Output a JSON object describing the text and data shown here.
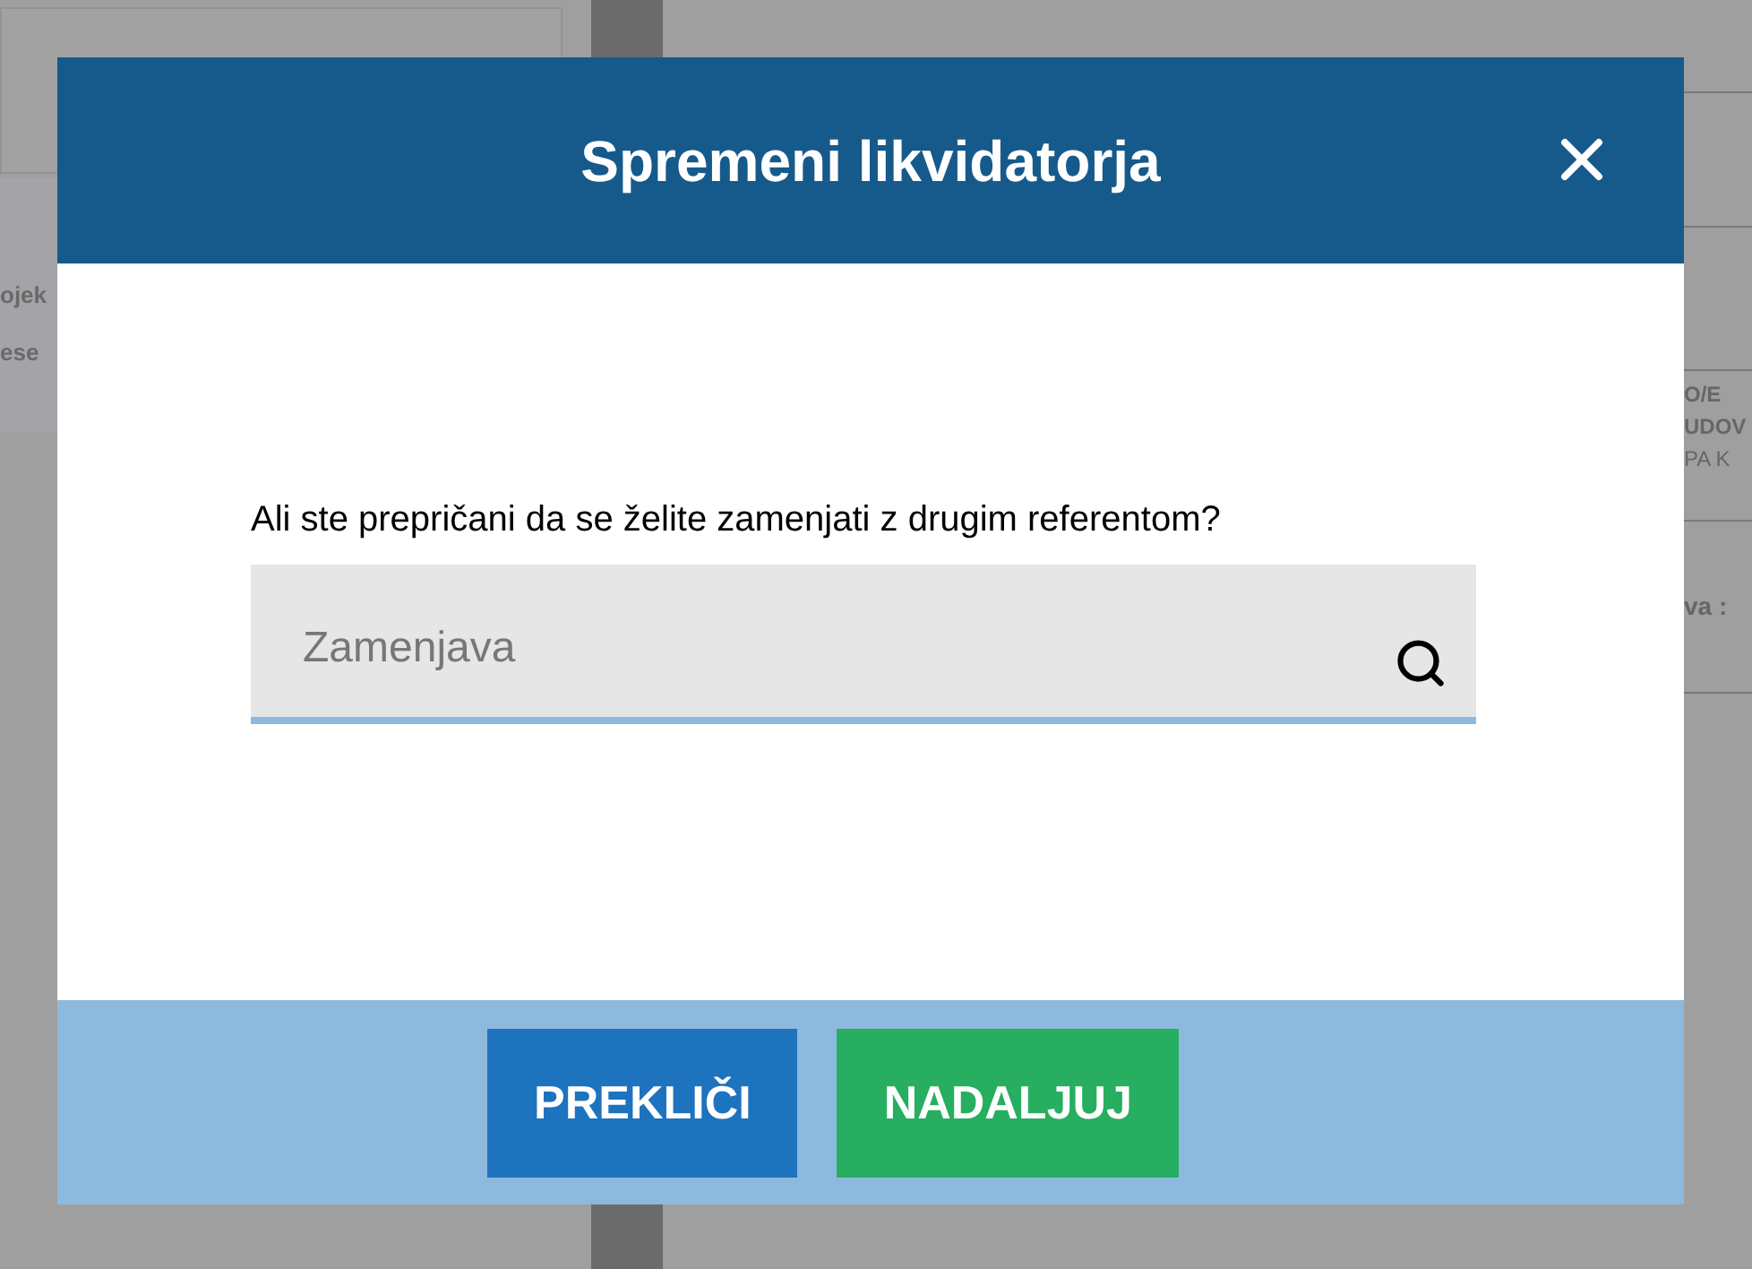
{
  "background": {
    "left_texts": [
      "ojek",
      "ese"
    ],
    "right_texts": [
      {
        "text": "O/E",
        "kind": "bold"
      },
      {
        "text": "UDOV",
        "kind": "bold"
      },
      {
        "text": "PA K",
        "kind": "plain"
      },
      {
        "text": "va :",
        "kind": "bold"
      }
    ]
  },
  "dialog": {
    "title": "Spremeni likvidatorja",
    "prompt": "Ali ste prepričani da se želite zamenjati z drugim referentom?",
    "search": {
      "placeholder": "Zamenjava"
    },
    "buttons": [
      {
        "label": "PREKLIČI",
        "kind": "cancel"
      },
      {
        "label": "NADALJUJ",
        "kind": "confirm"
      }
    ]
  }
}
